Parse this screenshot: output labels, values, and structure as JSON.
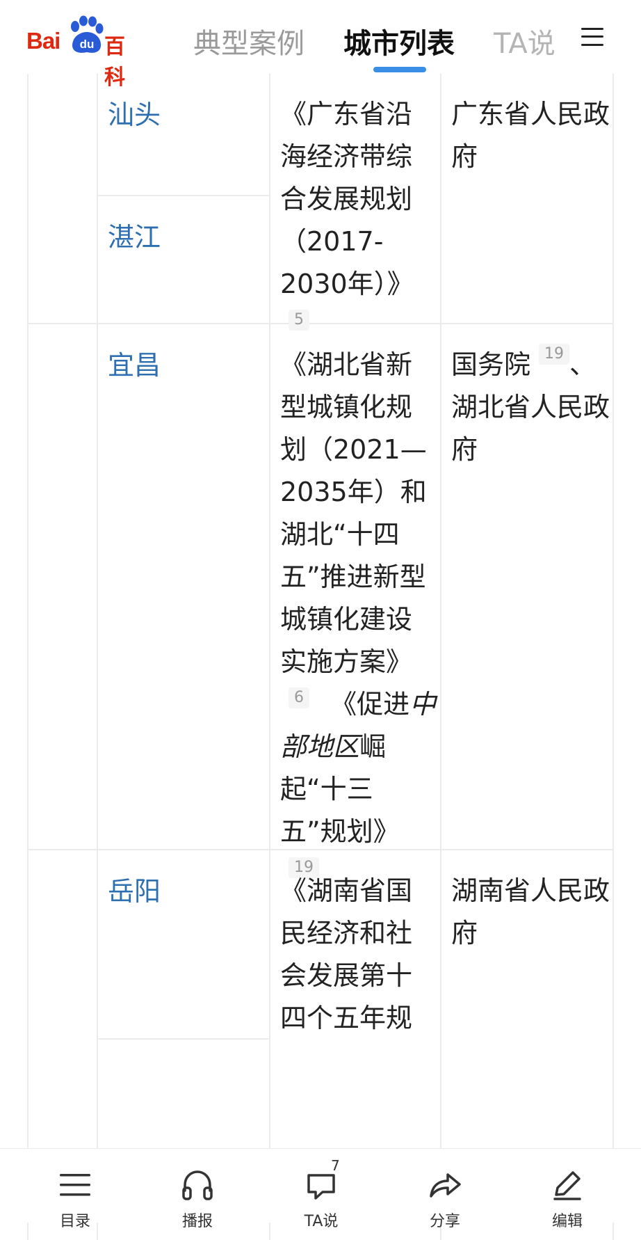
{
  "header": {
    "logo_text_a": "Bai",
    "logo_text_b": "百科",
    "logo_paw_text": "du",
    "tabs": [
      {
        "label": "典型案例",
        "active": false
      },
      {
        "label": "城市列表",
        "active": true
      },
      {
        "label": "TA说",
        "active": false
      }
    ],
    "menu_icon": "hamburger-menu-icon",
    "accent_color": "#3a8ee6",
    "brand_color": "#de2910"
  },
  "table": {
    "rows": [
      {
        "cities": [
          "汕头",
          "湛江"
        ],
        "plan_parts": [
          "《广东省沿海经济带综合发展规划（2017-2030年）》"
        ],
        "plan_ref": "5",
        "government": "广东省人民政府"
      },
      {
        "cities": [
          "宜昌"
        ],
        "plan_a": "《湖北省新型城镇化规划（2021—2035年）和湖北“十四五”推进新型城镇化建设实施方案》",
        "plan_a_ref": "6",
        "plan_b_pre": "《促进",
        "plan_b_italic": "中部地区",
        "plan_b_post": "崛起“十三五”规划》",
        "plan_b_ref": "19",
        "government_a": "国务院",
        "government_ref": "19",
        "government_b": "、湖北省人民政府"
      },
      {
        "cities": [
          "岳阳"
        ],
        "plan_text": "《湖南省国民经济和社会发展第十四个五年规",
        "government": "湖南省人民政府"
      }
    ],
    "link_color": "#2d6fb0"
  },
  "bottom_bar": {
    "items": [
      {
        "label": "目录",
        "icon": "list-icon"
      },
      {
        "label": "播报",
        "icon": "headphones-icon"
      },
      {
        "label": "TA说",
        "icon": "chat-bubble-icon",
        "badge": "7"
      },
      {
        "label": "分享",
        "icon": "share-arrow-icon"
      },
      {
        "label": "编辑",
        "icon": "pencil-icon"
      }
    ]
  }
}
